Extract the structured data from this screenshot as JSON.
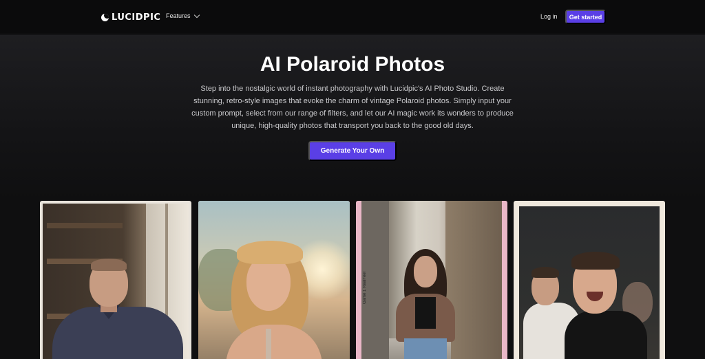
{
  "nav": {
    "logo_text": "LUCIDPIC",
    "features_label": "Features",
    "login_label": "Log in",
    "cta_label": "Get started"
  },
  "hero": {
    "title": "AI Polaroid Photos",
    "description": "Step into the nostalgic world of instant photography with Lucidpic's AI Photo Studio. Create stunning, retro-style images that evoke the charm of vintage Polaroid photos. Simply input your custom prompt, select from our range of filters, and let our AI magic work its wonders to produce unique, high-quality photos that transport you back to the good old days.",
    "cta_label": "Generate Your Own"
  },
  "gallery": {
    "photo3_side_text": "Game 1 RealFeel"
  },
  "colors": {
    "accent": "#5a3fe6",
    "background": "#0f0f10",
    "nav_background": "#0b0b0c"
  }
}
